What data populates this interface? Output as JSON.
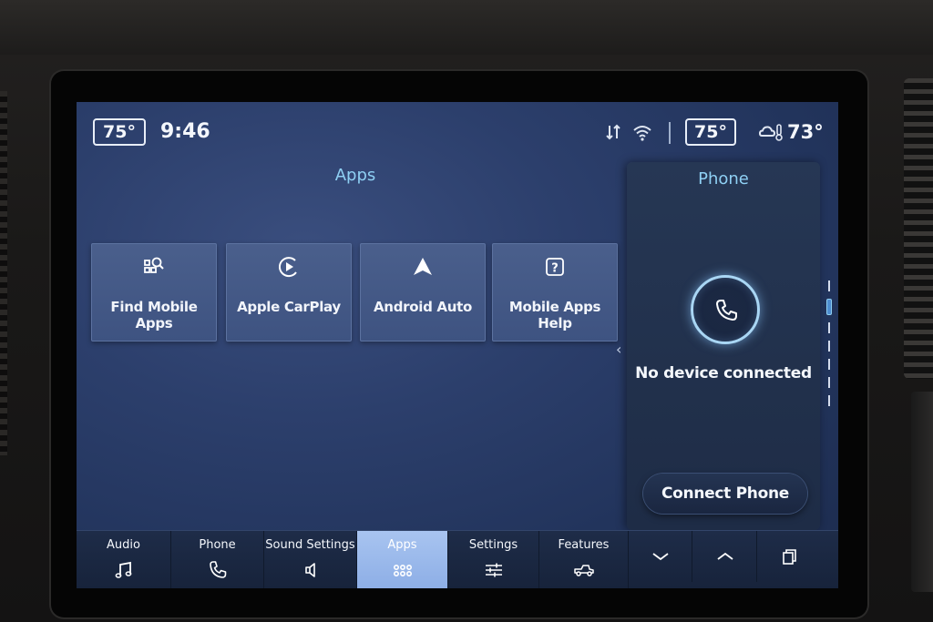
{
  "status_bar": {
    "cabin_temp_left": "75°",
    "time": "9:46",
    "cabin_temp_right": "75°",
    "outside_temp": "73°"
  },
  "apps_panel": {
    "title": "Apps",
    "tiles": [
      {
        "label": "Find Mobile Apps",
        "icon": "find-apps-icon"
      },
      {
        "label": "Apple CarPlay",
        "icon": "carplay-icon"
      },
      {
        "label": "Android Auto",
        "icon": "android-auto-icon"
      },
      {
        "label": "Mobile Apps Help",
        "icon": "help-icon"
      }
    ]
  },
  "phone_panel": {
    "title": "Phone",
    "status": "No device connected",
    "connect_label": "Connect Phone"
  },
  "bottom_nav": {
    "items": [
      {
        "label": "Audio",
        "icon": "music-note-icon"
      },
      {
        "label": "Phone",
        "icon": "phone-icon"
      },
      {
        "label": "Sound Settings",
        "icon": "speaker-icon"
      },
      {
        "label": "Apps",
        "icon": "apps-grid-icon",
        "active": true
      },
      {
        "label": "Settings",
        "icon": "sliders-icon"
      },
      {
        "label": "Features",
        "icon": "truck-icon"
      }
    ],
    "buttons": [
      "chevron-down-icon",
      "chevron-up-icon",
      "windows-icon"
    ]
  },
  "colors": {
    "accent": "#8fd0f4",
    "screen_bg": "#2c3f6c",
    "tile_bg": "#4a5f8c",
    "active_nav": "#a8c4f0"
  }
}
